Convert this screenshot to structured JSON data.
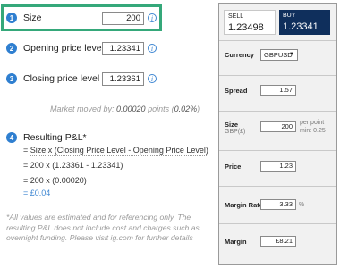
{
  "steps": [
    {
      "num": "1",
      "label": "Size",
      "value": "200"
    },
    {
      "num": "2",
      "label": "Opening price level",
      "value": "1.23341"
    },
    {
      "num": "3",
      "label": "Closing price level",
      "value": "1.23361"
    },
    {
      "num": "4",
      "label": "Resulting P&L*"
    }
  ],
  "market_moved": {
    "prefix": "Market moved by: ",
    "amount": "0.00020",
    "mid": " points (",
    "percent": "0.02%",
    "suffix": ")"
  },
  "calc": {
    "line1_prefix": "= ",
    "line1_formula": "Size x (Closing Price Level - Opening Price Level)",
    "line2": "= 200 x (1.23361 - 1.23341)",
    "line3": "= 200 x (0.00020)",
    "line4": "= £0.04"
  },
  "disclaimer": "*All values are estimated and for referencing only. The resulting P&L does not include cost and charges such as overnight funding. Please visit ig.com for further details",
  "panel": {
    "sell_label": "SELL",
    "sell_price": "1.23498",
    "buy_label": "BUY",
    "buy_price": "1.23341",
    "currency_label": "Currency",
    "currency_value": "GBPUSD",
    "spread_label": "Spread",
    "spread_value": "1.57",
    "size_label": "Size",
    "size_sub": "GBP(£)",
    "size_value": "200",
    "size_note_1": "per point",
    "size_note_2": "min: 0.25",
    "price_label": "Price",
    "price_value": "1.23",
    "margin_rate_label": "Margin Rate",
    "margin_rate_value": "3.33",
    "margin_rate_unit": "%",
    "margin_label": "Margin",
    "margin_value": "£8.21"
  }
}
